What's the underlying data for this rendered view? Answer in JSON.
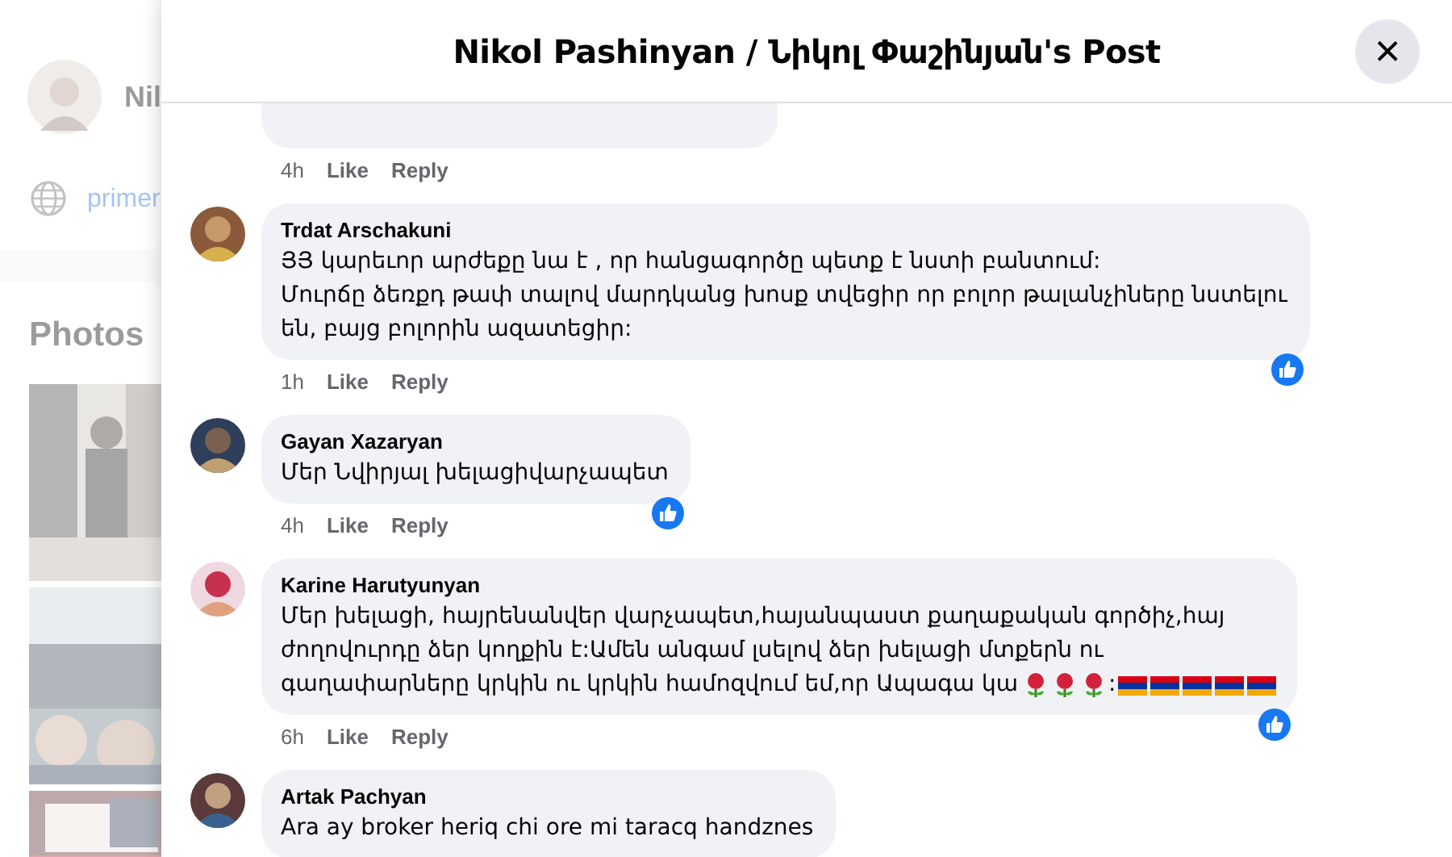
{
  "background": {
    "profile_name": "Nil",
    "link_text": "primer",
    "photos_heading": "Photos"
  },
  "dialog": {
    "title": "Nikol Pashinyan / Նիկոլ Փաշինյան's Post",
    "close_label": "×"
  },
  "top_comment": {
    "time": "4h",
    "like": "Like",
    "reply": "Reply"
  },
  "comments": [
    {
      "author": "Trdat Arschakuni",
      "lines": [
        "ՅՅ կարեւոր արժեքը նա է , որ հանցագործը պետք է նստի բանտում:",
        "Մուրճը ձեռքդ թափ տալով մարդկանց խոսք տվեցիր որ բոլոր թալանչիները նստելու",
        "են, բայց բոլորին ազատեցիր:"
      ],
      "time": "1h",
      "like": "Like",
      "reply": "Reply",
      "liked": true
    },
    {
      "author": "Gayan Xazaryan",
      "lines": [
        "Մեր Նվիրյալ խելացիվարչապետ"
      ],
      "time": "4h",
      "like": "Like",
      "reply": "Reply",
      "liked": true
    },
    {
      "author": "Karine Harutyunyan",
      "lines": [
        "Մեր խելացի, հայրենանվեր վարչապետ,հայանպաստ քաղաքական գործիչ,հայ",
        "ժողովուրդը ձեր կողքին է:Ամեն անգամ լսելով ձեր խելացի մտքերն ու",
        "գաղափարները կրկին ու կրկին համոզվում եմ,որ Ապագա կա"
      ],
      "emoji": [
        {
          "kind": "rose"
        },
        {
          "kind": "rose"
        },
        {
          "kind": "rose"
        },
        {
          "kind": "text",
          "text": ":"
        },
        {
          "kind": "flag"
        },
        {
          "kind": "flag"
        },
        {
          "kind": "flag"
        },
        {
          "kind": "flag"
        },
        {
          "kind": "flag"
        }
      ],
      "time": "6h",
      "like": "Like",
      "reply": "Reply",
      "liked": true
    },
    {
      "author": "Artak Pachyan",
      "lines": [
        "Ara ay broker heriq chi ore mi taracq handznes"
      ]
    }
  ]
}
